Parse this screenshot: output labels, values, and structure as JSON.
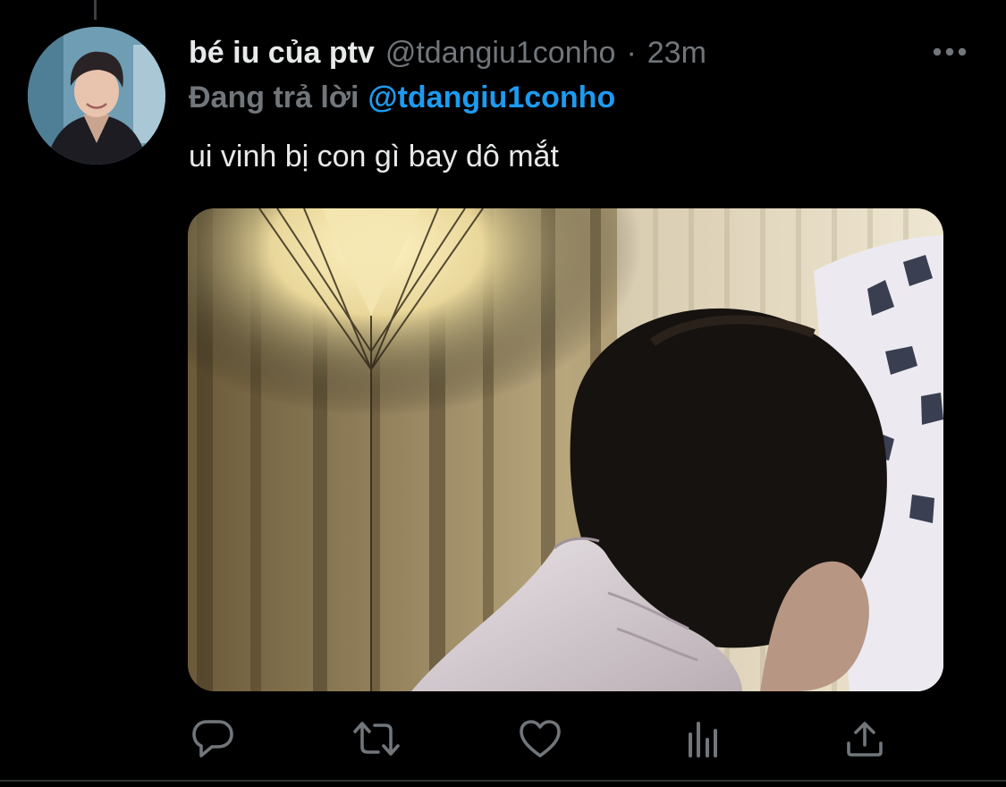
{
  "tweet": {
    "display_name": "bé iu của ptv",
    "handle": "@tdangiu1conho",
    "separator": "·",
    "time": "23m",
    "reply_prefix": "Đang trả lời",
    "reply_to": "@tdangiu1conho",
    "text": "ui vinh bị con gì bay dô mắt"
  },
  "icons": {
    "more": "more-horizontal-icon",
    "reply": "reply-bubble-icon",
    "retweet": "retweet-icon",
    "like": "heart-icon",
    "analytics": "analytics-bars-icon",
    "share": "share-upload-icon"
  },
  "colors": {
    "background": "#000000",
    "text_primary": "#e7e9ea",
    "text_secondary": "#71767b",
    "accent": "#1d9bf0",
    "divider": "#2f3336"
  }
}
